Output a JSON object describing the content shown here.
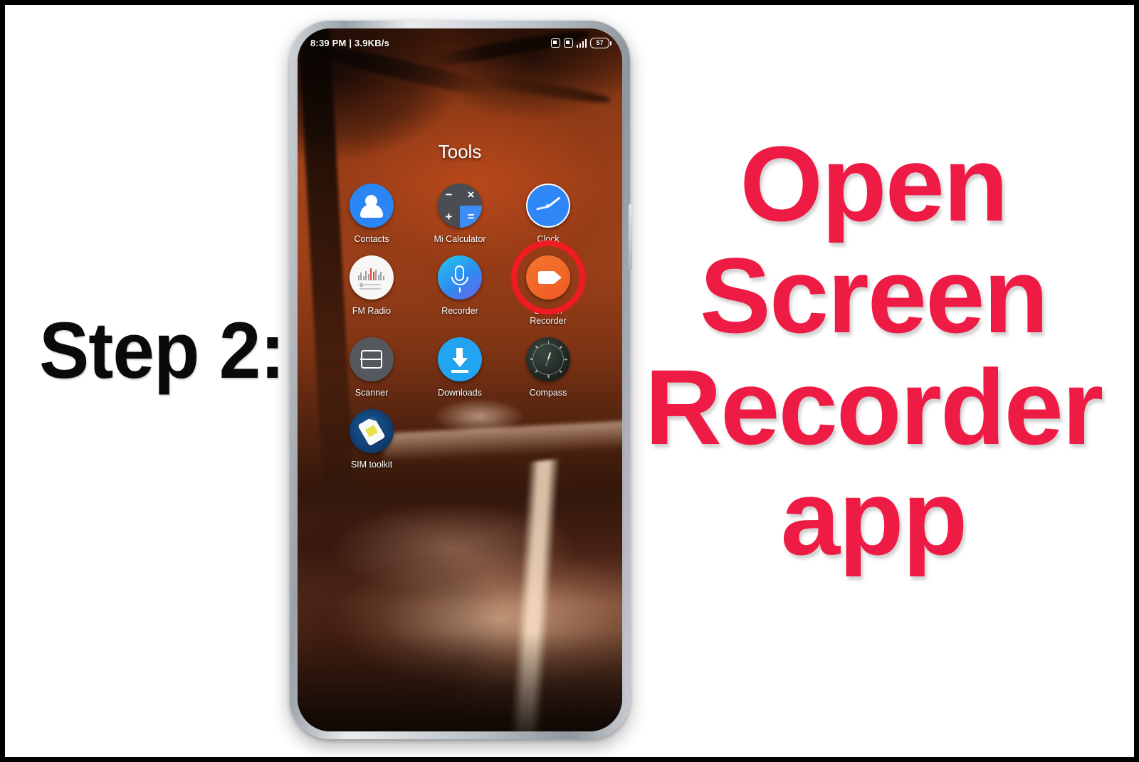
{
  "caption_left": {
    "text": "Step 2:"
  },
  "caption_right": {
    "color": "#ee1b44",
    "lines": [
      "Open",
      "Screen",
      "Recorder",
      "app"
    ]
  },
  "phone": {
    "status_bar": {
      "time_and_speed": "8:39 PM | 3.9KB/s",
      "battery_percent": "57"
    },
    "folder_title": "Tools",
    "highlight": {
      "target": "Screen Recorder",
      "ring_color": "#f01c21"
    },
    "apps": [
      [
        {
          "label": "Contacts",
          "icon": "contacts-icon"
        },
        {
          "label": "Mi Calculator",
          "icon": "calculator-icon"
        },
        {
          "label": "Clock",
          "icon": "clock-icon"
        }
      ],
      [
        {
          "label": "FM Radio",
          "icon": "fm-radio-icon"
        },
        {
          "label": "Recorder",
          "icon": "microphone-icon"
        },
        {
          "label": "Screen\nRecorder",
          "icon": "video-camera-icon"
        }
      ],
      [
        {
          "label": "Scanner",
          "icon": "scanner-icon"
        },
        {
          "label": "Downloads",
          "icon": "download-arrow-icon"
        },
        {
          "label": "Compass",
          "icon": "compass-icon"
        }
      ],
      [
        {
          "label": "SIM toolkit",
          "icon": "sim-card-icon"
        }
      ]
    ],
    "calculator_symbols": [
      "−",
      "×",
      "+",
      "="
    ]
  }
}
